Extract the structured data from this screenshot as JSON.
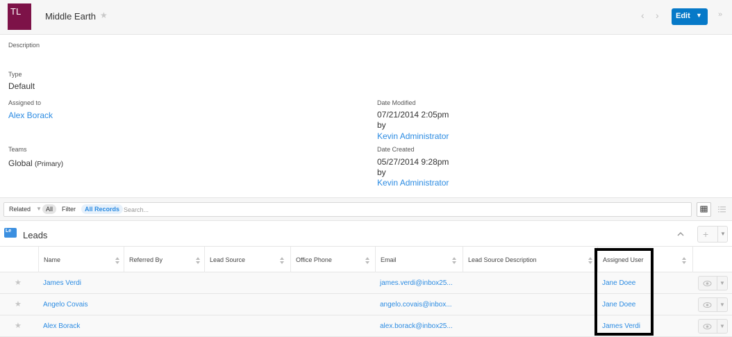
{
  "header": {
    "avatar_initials": "TL",
    "avatar_color": "#7d1248",
    "title": "Middle Earth",
    "favorite_icon": "star-icon",
    "edit_label": "Edit",
    "accent": "#0679c8"
  },
  "record": {
    "description_label": "Description",
    "type_label": "Type",
    "type_value": "Default",
    "assigned_to_label": "Assigned to",
    "assigned_to_value": "Alex Borack",
    "teams_label": "Teams",
    "teams_value": "Global",
    "teams_primary": "(Primary)",
    "date_modified_label": "Date Modified",
    "date_modified_value": "07/21/2014 2:05pm",
    "date_modified_by": "by",
    "date_modified_user": "Kevin Administrator",
    "date_created_label": "Date Created",
    "date_created_value": "05/27/2014 9:28pm",
    "date_created_by": "by",
    "date_created_user": "Kevin Administrator"
  },
  "filter": {
    "related_label": "Related",
    "all_label": "All",
    "filter_label": "Filter",
    "records_label": "All Records",
    "search_placeholder": "Search..."
  },
  "leads": {
    "badge": "Le",
    "title": "Leads",
    "columns": [
      "Name",
      "Referred By",
      "Lead Source",
      "Office Phone",
      "Email",
      "Lead Source Description",
      "Assigned User"
    ],
    "rows": [
      {
        "name": "James Verdi",
        "email": "james.verdi@inbox25...",
        "assigned": "Jane Doee"
      },
      {
        "name": "Angelo Covais",
        "email": "angelo.covais@inbox...",
        "assigned": "Jane Doee"
      },
      {
        "name": "Alex Borack",
        "email": "alex.borack@inbox25...",
        "assigned": "James Verdi"
      }
    ]
  }
}
